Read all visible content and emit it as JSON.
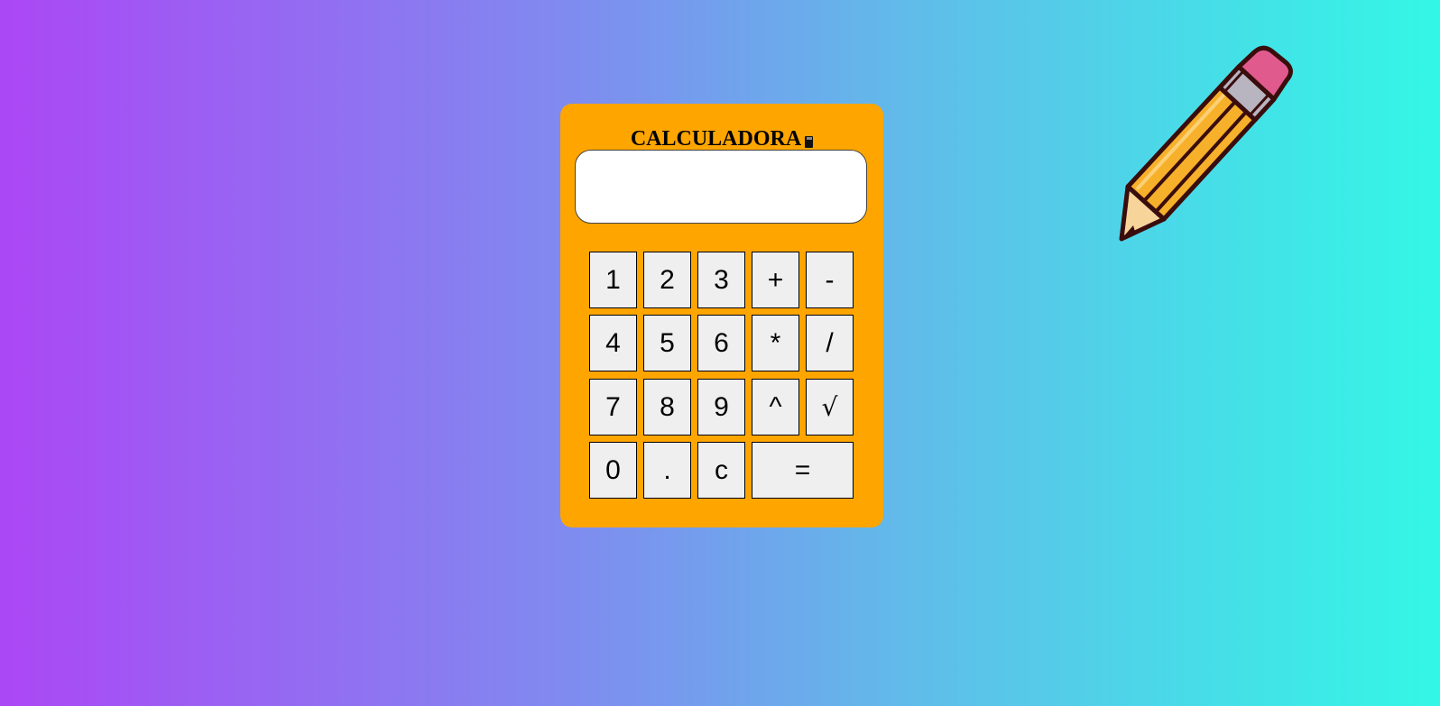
{
  "calculator": {
    "title": "CALCULADORA",
    "title_icon": "calculator-icon",
    "display_value": "",
    "keys": [
      {
        "label": "1",
        "name": "key-1"
      },
      {
        "label": "2",
        "name": "key-2"
      },
      {
        "label": "3",
        "name": "key-3"
      },
      {
        "label": "+",
        "name": "key-plus"
      },
      {
        "label": "-",
        "name": "key-minus"
      },
      {
        "label": "4",
        "name": "key-4"
      },
      {
        "label": "5",
        "name": "key-5"
      },
      {
        "label": "6",
        "name": "key-6"
      },
      {
        "label": "*",
        "name": "key-multiply"
      },
      {
        "label": "/",
        "name": "key-divide"
      },
      {
        "label": "7",
        "name": "key-7"
      },
      {
        "label": "8",
        "name": "key-8"
      },
      {
        "label": "9",
        "name": "key-9"
      },
      {
        "label": "^",
        "name": "key-power"
      },
      {
        "label": "√",
        "name": "key-sqrt"
      },
      {
        "label": "0",
        "name": "key-0"
      },
      {
        "label": ".",
        "name": "key-decimal"
      },
      {
        "label": "c",
        "name": "key-clear"
      },
      {
        "label": "=",
        "name": "key-equals"
      }
    ]
  },
  "decoration": {
    "icon": "pencil-icon"
  },
  "colors": {
    "calculator_body": "#ffa500",
    "key_background": "#efefef",
    "gradient_start": "#ab47f5",
    "gradient_end": "#33f7e6"
  }
}
